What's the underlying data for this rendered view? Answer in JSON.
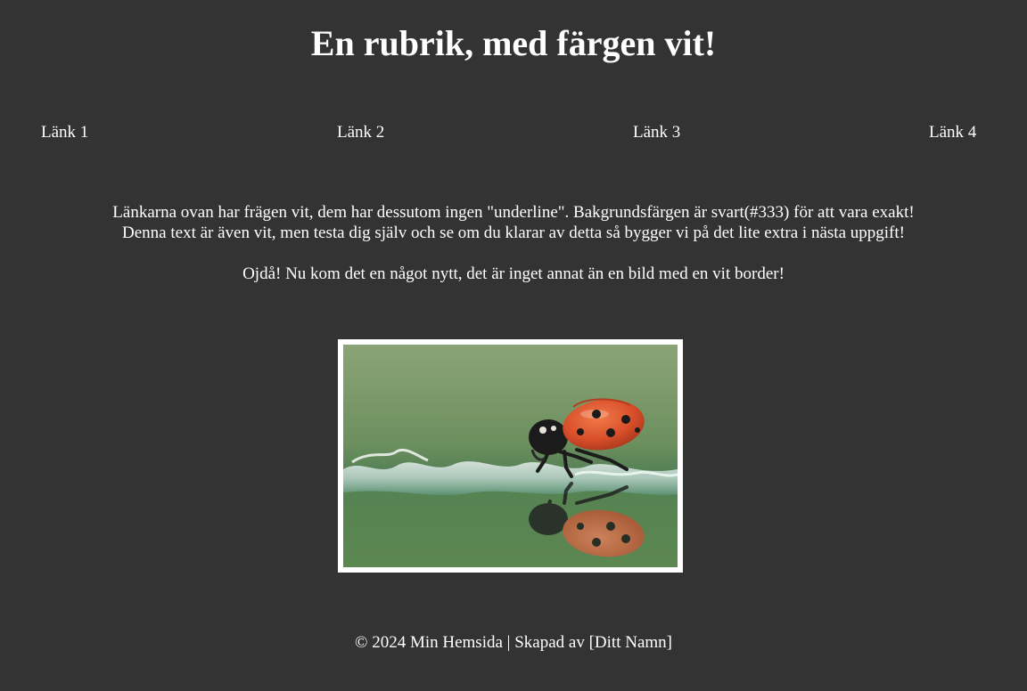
{
  "header": {
    "title": "En rubrik, med färgen vit!"
  },
  "nav": {
    "links": [
      {
        "label": "Länk 1"
      },
      {
        "label": "Länk 2"
      },
      {
        "label": "Länk 3"
      },
      {
        "label": "Länk 4"
      }
    ]
  },
  "main": {
    "line1": "Länkarna ovan har frägen vit, dem har dessutom ingen \"underline\". Bakgrundsfärgen är svart(#333) för att vara exakt!",
    "line2": "Denna text är även vit, men testa dig själv och se om du klarar av detta så bygger vi på det lite extra i nästa uppgift!",
    "line3": "Ojdå! Nu kom det en något nytt, det är inget annat än en bild med en vit border!"
  },
  "image": {
    "subject": "ladybug-photo",
    "border_color": "#ffffff"
  },
  "footer": {
    "text": "© 2024 Min Hemsida | Skapad av [Ditt Namn]"
  },
  "colors": {
    "background": "#333333",
    "text": "#ffffff"
  }
}
